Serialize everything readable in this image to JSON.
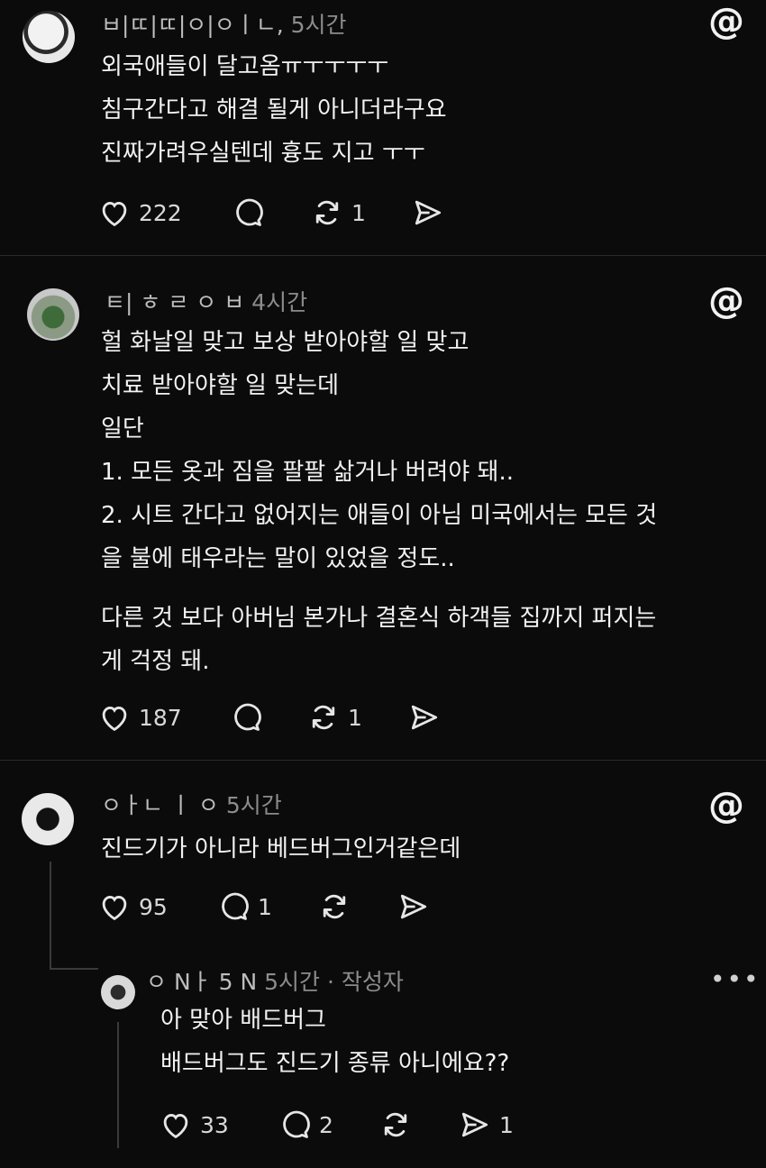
{
  "posts": [
    {
      "username": "ㅂ|ㄸ|ㄸ|ㅇ|ㅇㅣㄴ,",
      "time": "5시간",
      "lines": [
        "외국애들이 달고옴ㅠㅜㅜㅜㅜ",
        "침구간다고 해결 될게 아니더라구요",
        "진짜가려우실텐데 흉도 지고 ㅜㅜ"
      ],
      "likes": "222",
      "comments": "",
      "reposts": "1",
      "shares": ""
    },
    {
      "username": "ㅌ| ㅎ ㄹ ㅇ ㅂ",
      "time": "4시간",
      "lines": [
        "헐 화날일 맞고 보상 받아야할 일 맞고",
        "치료 받아야할 일 맞는데",
        "일단",
        "1. 모든 옷과 짐을 팔팔 삶거나 버려야 돼..",
        "2. 시트 간다고 없어지는 애들이 아님 미국에서는 모든 것",
        "을 불에 태우라는 말이 있었을 정도.."
      ],
      "lines2": [
        "다른 것 보다 아버님 본가나 결혼식 하객들 집까지 퍼지는",
        "게 걱정 돼."
      ],
      "likes": "187",
      "comments": "",
      "reposts": "1",
      "shares": ""
    },
    {
      "username": "ㅇㅏㄴ ㅣ ㅇ",
      "time": "5시간",
      "lines": [
        "진드기가 아니라 베드버그인거같은데"
      ],
      "likes": "95",
      "comments": "1",
      "reposts": "",
      "shares": ""
    },
    {
      "username": "ㅇ Nㅏ 5 N",
      "time": "5시간",
      "badge": "· 작성자",
      "lines": [
        "아 맞아 배드버그",
        "배드버그도 진드기 종류 아니에요??"
      ],
      "likes": "33",
      "comments": "2",
      "reposts": "",
      "shares": "1"
    }
  ],
  "icons": {
    "threads": "threads-logo-icon",
    "like": "heart-icon",
    "comment": "comment-icon",
    "repost": "repost-icon",
    "share": "share-icon",
    "more": "more-icon"
  },
  "more_label": "•••"
}
